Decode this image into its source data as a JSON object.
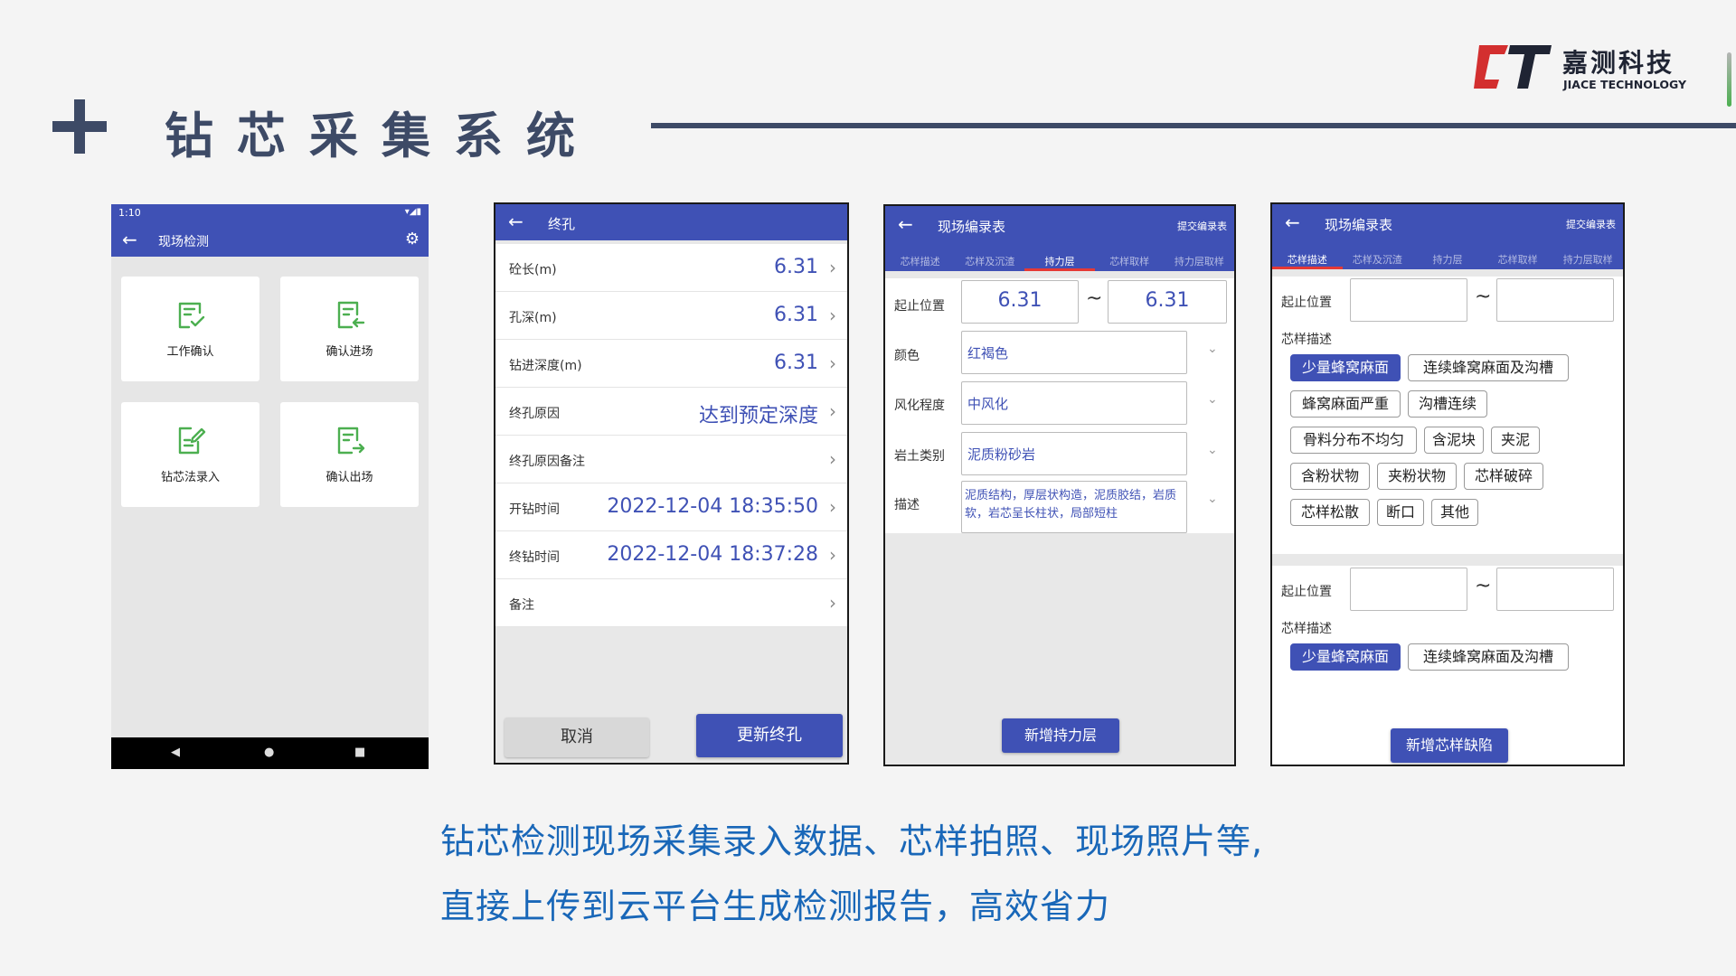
{
  "slide": {
    "title": "钻芯采集系统",
    "logo_cn": "嘉测科技",
    "logo_en": "JIACE TECHNOLOGY",
    "caption_line1": "钻芯检测现场采集录入数据、芯样拍照、现场照片等,",
    "caption_line2": "直接上传到云平台生成检测报告，高效省力"
  },
  "colors": {
    "accent": "#3f51b5",
    "title": "#3d4a66",
    "caption": "#1967b8",
    "logo_red": "#d32f2f",
    "tile_icon": "#4caf50"
  },
  "phone1": {
    "status_time": "1:10",
    "title": "现场检测",
    "tiles": [
      {
        "label": "工作确认",
        "icon": "check-document-icon"
      },
      {
        "label": "确认进场",
        "icon": "enter-document-icon"
      },
      {
        "label": "钻芯法录入",
        "icon": "edit-document-icon"
      },
      {
        "label": "确认出场",
        "icon": "exit-document-icon"
      }
    ]
  },
  "phone2": {
    "title": "终孔",
    "rows": [
      {
        "label": "砼长(m)",
        "value": "6.31"
      },
      {
        "label": "孔深(m)",
        "value": "6.31"
      },
      {
        "label": "钻进深度(m)",
        "value": "6.31"
      },
      {
        "label": "终孔原因",
        "value": "达到预定深度"
      },
      {
        "label": "终孔原因备注",
        "value": ""
      },
      {
        "label": "开钻时间",
        "value": "2022-12-04 18:35:50"
      },
      {
        "label": "终钻时间",
        "value": "2022-12-04 18:37:28"
      },
      {
        "label": "备注",
        "value": ""
      }
    ],
    "cancel_label": "取消",
    "confirm_label": "更新终孔"
  },
  "phone3": {
    "title": "现场编录表",
    "submit_label": "提交编录表",
    "tabs": [
      "芯样描述",
      "芯样及沉渣",
      "持力层",
      "芯样取样",
      "持力层取样"
    ],
    "active_tab": 2,
    "range_label": "起止位置",
    "range_from": "6.31",
    "range_to": "6.31",
    "tilde": "~",
    "fields": [
      {
        "label": "颜色",
        "value": "红褐色"
      },
      {
        "label": "风化程度",
        "value": "中风化"
      },
      {
        "label": "岩土类别",
        "value": "泥质粉砂岩"
      }
    ],
    "desc_label": "描述",
    "desc_value": "泥质结构，厚层状构造，泥质胶结，岩质软，岩芯呈长柱状，局部短柱",
    "add_label": "新增持力层"
  },
  "phone4": {
    "title": "现场编录表",
    "submit_label": "提交编录表",
    "tabs": [
      "芯样描述",
      "芯样及沉渣",
      "持力层",
      "芯样取样",
      "持力层取样"
    ],
    "active_tab": 0,
    "range_label": "起止位置",
    "tilde": "~",
    "desc_label": "芯样描述",
    "chips": [
      "少量蜂窝麻面",
      "连续蜂窝麻面及沟槽",
      "蜂窝麻面严重",
      "沟槽连续",
      "骨料分布不均匀",
      "含泥块",
      "夹泥",
      "含粉状物",
      "夹粉状物",
      "芯样破碎",
      "芯样松散",
      "断口",
      "其他"
    ],
    "chips2": [
      "少量蜂窝麻面",
      "连续蜂窝麻面及沟槽"
    ],
    "add_label": "新增芯样缺陷"
  }
}
